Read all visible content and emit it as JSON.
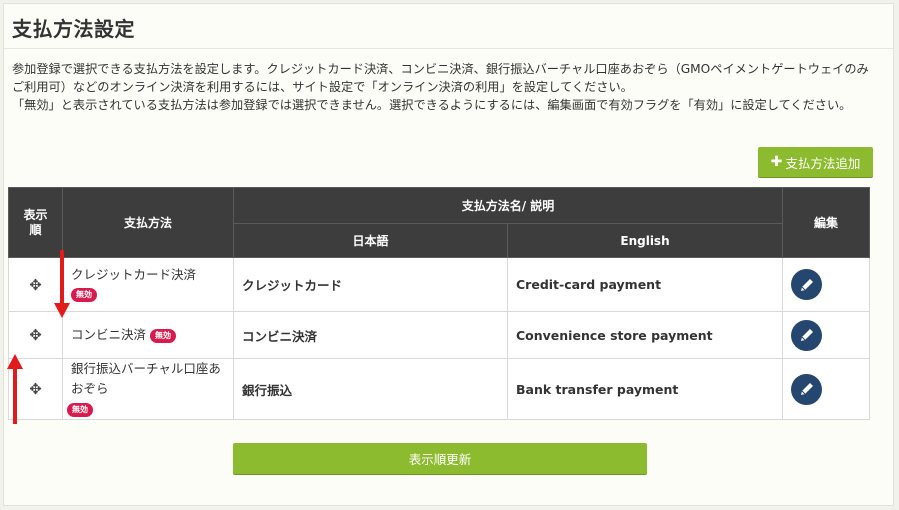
{
  "page": {
    "title": "支払方法設定",
    "description": [
      "参加登録で選択できる支払方法を設定します。クレジットカード決済、コンビニ決済、銀行振込バーチャル口座あおぞら（GMOペイメントゲートウェイのみご利用可）などのオンライン決済を利用するには、サイト設定で「オンライン決済の利用」を設定してください。",
      "「無効」と表示されている支払方法は参加登録では選択できません。選択できるようにするには、編集画面で有効フラグを「有効」に設定してください。"
    ],
    "add_button": "支払方法追加",
    "update_button": "表示順更新"
  },
  "table": {
    "headers": {
      "order": "表示順",
      "method": "支払方法",
      "name_desc": "支払方法名/ 説明",
      "japanese": "日本語",
      "english": "English",
      "edit": "編集"
    },
    "rows": [
      {
        "method": "クレジットカード決済",
        "status": "無効",
        "name_ja": "クレジットカード",
        "name_en": "Credit-card payment"
      },
      {
        "method": "コンビニ決済",
        "status": "無効",
        "name_ja": "コンビニ決済",
        "name_en": "Convenience store payment"
      },
      {
        "method": "銀行振込バーチャル口座あおぞら",
        "status": "無効",
        "name_ja": "銀行振込",
        "name_en": "Bank transfer payment"
      }
    ]
  },
  "icons": {
    "drag_handle": "move-arrows-icon",
    "edit": "pencil-icon",
    "add": "plus-icon"
  },
  "colors": {
    "header_bg": "#3d3d3d",
    "accent_green": "#8dbb2f",
    "badge_red": "#d81b4e",
    "edit_navy": "#25466e",
    "annotation_red": "#e01b1b"
  }
}
